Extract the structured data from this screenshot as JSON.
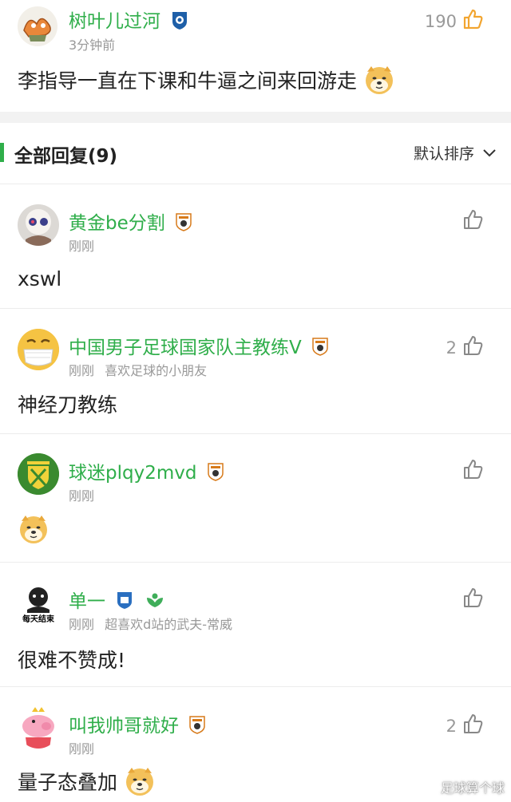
{
  "top_comment": {
    "user": "树叶儿过河",
    "time": "3分钟前",
    "likes": "190",
    "text": "李指导一直在下课和牛逼之间来回游走"
  },
  "replies_header": {
    "title": "全部回复(9)",
    "sort": "默认排序"
  },
  "replies": [
    {
      "user": "黄金be分割",
      "time": "刚刚",
      "tag": "",
      "likes": "",
      "text": "xswl"
    },
    {
      "user": "中国男子足球国家队主教练V",
      "time": "刚刚",
      "tag": "喜欢足球的小朋友",
      "likes": "2",
      "text": "神经刀教练"
    },
    {
      "user": "球迷plqy2mvd",
      "time": "刚刚",
      "tag": "",
      "likes": "",
      "text": ""
    },
    {
      "user": "单一",
      "time": "刚刚",
      "tag": "超喜欢d站的武夫-常威",
      "likes": "",
      "text": "很难不赞成!"
    },
    {
      "user": "叫我帅哥就好",
      "time": "刚刚",
      "tag": "",
      "likes": "2",
      "text": "量子态叠加"
    }
  ],
  "avatar_text": {
    "r4": "每天结束"
  },
  "watermark": "足球算个球",
  "colors": {
    "accent": "#2fae4a",
    "meta": "#999999",
    "text": "#222222",
    "bg": "#f2f2f2"
  }
}
